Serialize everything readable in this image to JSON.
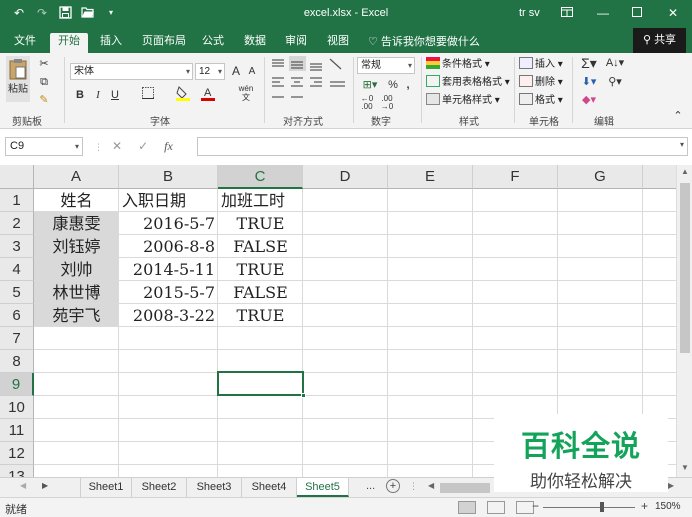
{
  "window": {
    "title": "excel.xlsx  -  Excel",
    "user": "tr sv",
    "qat": [
      "undo-icon",
      "redo-icon",
      "save-icon",
      "open-icon",
      "customize-icon"
    ],
    "controls": [
      "ribbon-display-icon",
      "minimize-icon",
      "maximize-icon",
      "close-icon"
    ]
  },
  "ribbon": {
    "tabs": [
      "文件",
      "开始",
      "插入",
      "页面布局",
      "公式",
      "数据",
      "审阅",
      "视图"
    ],
    "active_tab": "开始",
    "tell_me": "告诉我你想要做什么",
    "share": "共享",
    "clipboard": {
      "paste": "粘贴",
      "label": "剪贴板"
    },
    "font": {
      "name": "宋体",
      "size": "12",
      "label": "字体",
      "bold": "B",
      "italic": "I",
      "underline": "U",
      "grow": "A",
      "shrink": "A",
      "phonetic": "wén"
    },
    "alignment": {
      "label": "对齐方式"
    },
    "number": {
      "format": "常规",
      "label": "数字"
    },
    "styles": {
      "conditional": "条件格式",
      "table": "套用表格格式",
      "cell": "单元格样式",
      "label": "样式"
    },
    "cells": {
      "insert": "插入",
      "delete": "删除",
      "format": "格式",
      "label": "单元格"
    },
    "editing": {
      "label": "编辑"
    }
  },
  "formula_bar": {
    "name_box": "C9",
    "formula": ""
  },
  "grid": {
    "columns": [
      "A",
      "B",
      "C",
      "D",
      "E",
      "F",
      "G"
    ],
    "selected_column": "C",
    "rows": [
      "1",
      "2",
      "3",
      "4",
      "5",
      "6",
      "7",
      "8",
      "9",
      "10",
      "11",
      "12",
      "13"
    ],
    "selected_row": "9",
    "headers": [
      "姓名",
      "入职日期",
      "加班工时"
    ],
    "data": [
      [
        "康惠雯",
        "2016-5-7",
        "TRUE"
      ],
      [
        "刘钰婷",
        "2006-8-8",
        "FALSE"
      ],
      [
        "刘帅",
        "2014-5-11",
        "TRUE"
      ],
      [
        "林世博",
        "2015-5-7",
        "FALSE"
      ],
      [
        "苑宇飞",
        "2008-3-22",
        "TRUE"
      ]
    ]
  },
  "sheets": [
    "Sheet1",
    "Sheet2",
    "Sheet3",
    "Sheet4",
    "Sheet5"
  ],
  "active_sheet": "Sheet5",
  "status": {
    "ready": "就绪",
    "zoom": "150%"
  },
  "watermark": {
    "title": "百科全说",
    "subtitle": "助你轻松解决"
  },
  "colors": {
    "accent": "#217346",
    "watermark_green": "#13a35a",
    "selection_shade": "#d9d9d9"
  }
}
